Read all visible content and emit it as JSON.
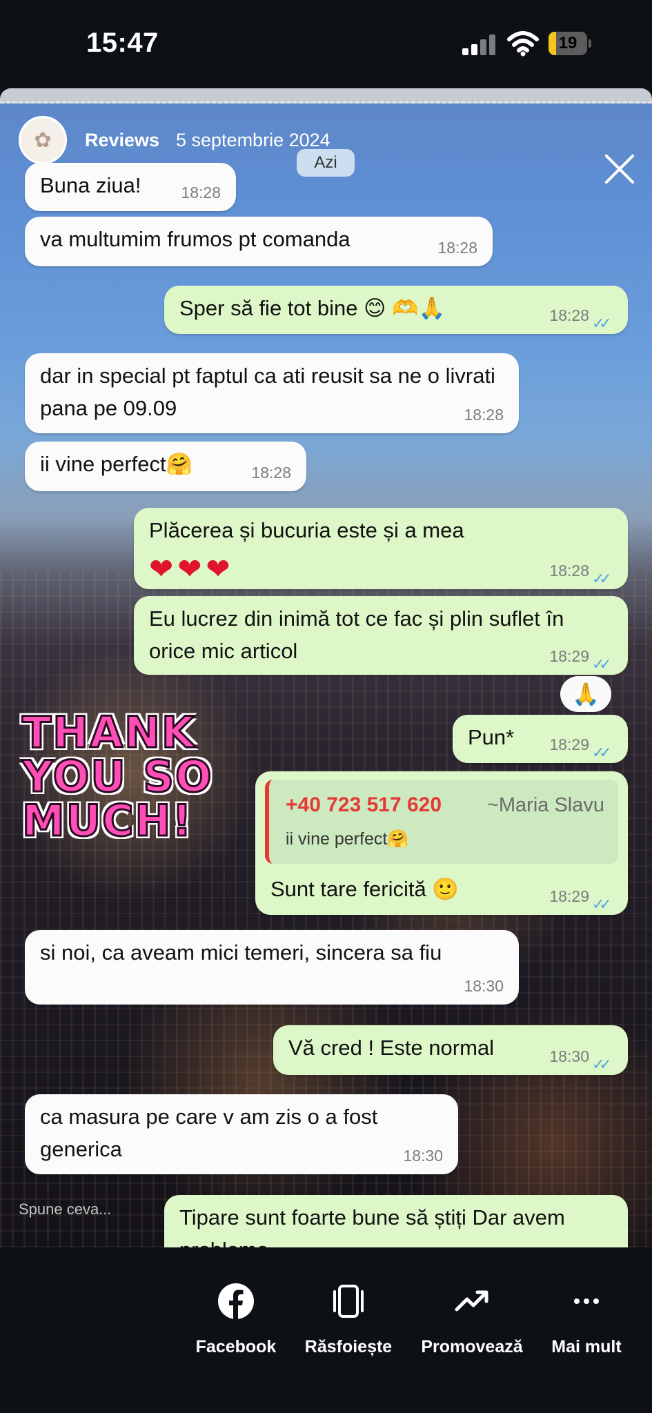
{
  "status_bar": {
    "time": "15:47",
    "battery_level": "19",
    "battery_fraction": 0.19,
    "battery_color": "#f5c518"
  },
  "story": {
    "account_name": "Reviews",
    "date": "5 septembrie 2024",
    "chat_date_pill": "Azi",
    "avatar_icon": "brand-logo-icon",
    "close_icon": "close-icon"
  },
  "messages": [
    {
      "dir": "in",
      "text": "Buna ziua!",
      "time": "18:28"
    },
    {
      "dir": "in",
      "text": "va multumim frumos pt comanda",
      "time": "18:28"
    },
    {
      "dir": "out",
      "text": "Sper să fie tot bine 😊 🫶🙏",
      "time": "18:28"
    },
    {
      "dir": "in",
      "text": "dar in special pt faptul ca ati reusit sa ne o livrati pana pe 09.09",
      "time": "18:28"
    },
    {
      "dir": "in",
      "text": "ii vine perfect🤗",
      "time": "18:28"
    },
    {
      "dir": "out",
      "text": "Plăcerea și bucuria este și a mea",
      "hearts": "❤❤❤",
      "time": "18:28"
    },
    {
      "dir": "out",
      "text": "Eu lucrez din inimă tot ce fac și plin suflet în orice mic articol",
      "time": "18:29"
    },
    {
      "dir": "out",
      "text": "Pun*",
      "time": "18:29"
    },
    {
      "dir": "out",
      "text": "Sunt tare fericită 🙂",
      "time": "18:29"
    },
    {
      "dir": "in",
      "text": "si noi, ca aveam mici temeri, sincera sa fiu",
      "time": "18:30"
    },
    {
      "dir": "out",
      "text": "Vă cred ! Este normal",
      "time": "18:30"
    },
    {
      "dir": "in",
      "text": "ca masura pe care v am zis o a fost generica",
      "time": "18:30"
    },
    {
      "dir": "out",
      "text": "Tipare sunt foarte bune să știți Dar avem probleme"
    }
  ],
  "reaction": "🙏",
  "ticks": "✓✓",
  "sticker_text": "THANK YOU SO MUCH!",
  "quote": {
    "phone": "+40 723 517 620",
    "name": "~Maria Slavu",
    "text": "ii vine perfect🤗"
  },
  "reply_placeholder": "Spune ceva...",
  "bottom_actions": [
    {
      "label": "Facebook",
      "icon": "facebook-icon"
    },
    {
      "label": "Răsfoiește",
      "icon": "browse-cards-icon"
    },
    {
      "label": "Promovează",
      "icon": "trending-up-icon"
    },
    {
      "label": "Mai mult",
      "icon": "more-dots-icon"
    }
  ],
  "colors": {
    "incoming_bubble": "#fbfbfb",
    "outgoing_bubble": "#ddf7c8",
    "read_ticks": "#4fa6e6",
    "quote_accent": "#e53935",
    "sticker_pink": "#ff4fb6"
  }
}
